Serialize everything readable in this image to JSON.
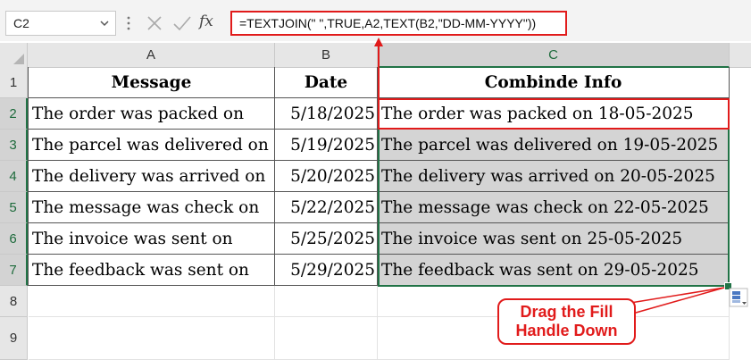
{
  "formula_bar": {
    "name_box": "C2",
    "fx": "fx",
    "formula": "=TEXTJOIN(\" \",TRUE,A2,TEXT(B2,\"DD-MM-YYYY\"))"
  },
  "columns": [
    "A",
    "B",
    "C"
  ],
  "rows": [
    "1",
    "2",
    "3",
    "4",
    "5",
    "6",
    "7",
    "8",
    "9"
  ],
  "headers": {
    "message": "Message",
    "date": "Date",
    "info": "Combinde Info"
  },
  "data_rows": [
    {
      "message": "The order was packed on",
      "date": "5/18/2025",
      "info": "The order was packed on 18-05-2025"
    },
    {
      "message": "The parcel was delivered on",
      "date": "5/19/2025",
      "info": "The parcel was delivered on 19-05-2025"
    },
    {
      "message": "The delivery was arrived on",
      "date": "5/20/2025",
      "info": "The delivery was arrived on 20-05-2025"
    },
    {
      "message": "The message was check on",
      "date": "5/22/2025",
      "info": "The message was check on 22-05-2025"
    },
    {
      "message": "The invoice was sent on",
      "date": "5/25/2025",
      "info": "The invoice was sent on 25-05-2025"
    },
    {
      "message": "The feedback was sent on",
      "date": "5/29/2025",
      "info": "The feedback was sent on 29-05-2025"
    }
  ],
  "callout": {
    "line1": "Drag the Fill",
    "line2": "Handle Down"
  },
  "colors": {
    "accent_red": "#e11b1b",
    "excel_green": "#217346",
    "fill_gray": "#d4d4d4"
  }
}
